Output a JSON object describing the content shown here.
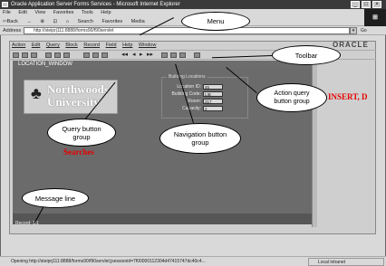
{
  "ie": {
    "title": "Oracle Application Server Forms Services - Microsoft Internet Explorer",
    "window_controls": [
      "_",
      "□",
      "×"
    ],
    "menu": [
      "File",
      "Edit",
      "View",
      "Favorites",
      "Tools",
      "Help"
    ],
    "toolbar": [
      "⇦Back",
      "→",
      "⊗",
      "⊡",
      "⌂",
      "Search",
      "Favorites",
      "Media"
    ],
    "address_label": "Address",
    "address_value": "http://steiprj111:8888/forms90/f90servlet",
    "go_label": "Go",
    "status_text": "Opening http://steiprj111:8888/forms90/f90servlet;jsessionid=7f00000112304d47415747dc40c4...",
    "zone_text": "Local intranet"
  },
  "forms": {
    "menu": [
      "Action",
      "Edit",
      "Query",
      "Block",
      "Record",
      "Field",
      "Help",
      "Window"
    ],
    "logo_text": "ORACLE",
    "window_title": "LOCATION_WINDOW",
    "university_logo_text": "Northwoods University",
    "bldg_legend": "Building Locations",
    "fields": [
      {
        "label": "Location ID:",
        "value": "45"
      },
      {
        "label": "Building Code:",
        "value": "LIB"
      },
      {
        "label": "Room:",
        "value": "217"
      },
      {
        "label": "Capacity:",
        "value": "2"
      }
    ],
    "record_status": "Record: 1/1"
  },
  "annotations": {
    "menu": "Menu",
    "toolbar": "Toolbar",
    "action_query": "Action query button group",
    "action_query_note": "INSERT, D",
    "query_group": "Query button group",
    "query_note": "Searches",
    "nav_group": "Navigation button group",
    "message_line": "Message line"
  },
  "colors": {
    "note_red": "#e60000",
    "window_bg": "#6b6b6b",
    "titlebar": "#3a3a3a"
  }
}
